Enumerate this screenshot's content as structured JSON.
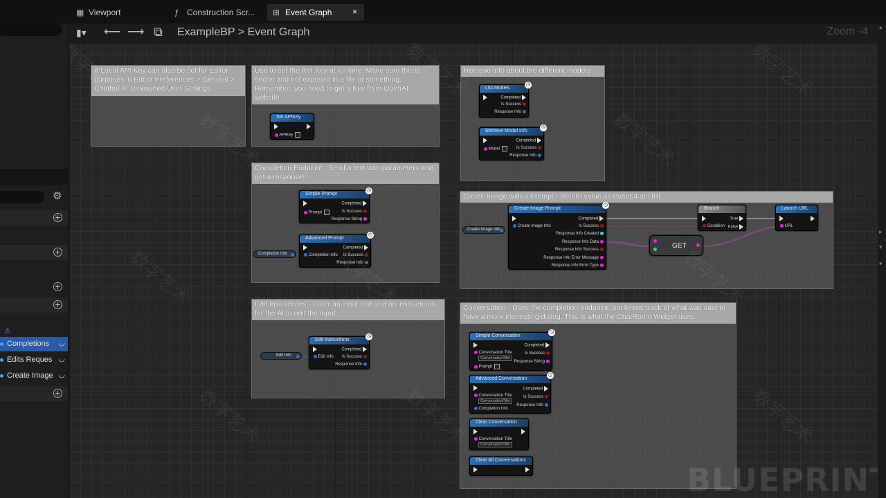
{
  "tabs": [
    {
      "label": "Viewport",
      "icon": "viewport-icon"
    },
    {
      "label": "Construction Scr...",
      "icon": "function-icon"
    },
    {
      "label": "Event Graph",
      "icon": "graph-icon",
      "close": "×"
    }
  ],
  "toolbar": {
    "breadcrumb_root": "ExampleBP",
    "separator": ">",
    "breadcrumb_leaf": "Event Graph",
    "zoom": "Zoom -4"
  },
  "left_panel": {
    "items": [
      {
        "label": "Completions"
      },
      {
        "label": "Edits Reques"
      },
      {
        "label": "Create Image"
      }
    ]
  },
  "comments": [
    {
      "text": "A Local API Key can also be set for Editor purposes in Editor Preferences > General > Chatbot AI Unleashed User Settings"
    },
    {
      "text": "Use to set the API Key at runtime. Make sure this is secret and not exposed in a file or something. Remember, you need to get a Key from OpenAI website."
    },
    {
      "text": "Retrieve info about the different models"
    },
    {
      "text": "Completion Endpoint : Send a text with parameters and get a response!"
    },
    {
      "text": "Create Image with a Prompt - Return value as Base64 or URL"
    },
    {
      "text": "Edit Instructions - Enter an input text and an instructions for the AI to edit the input."
    },
    {
      "text": "Conversation - Uses the completion endpoint, but keeps track of what was said to have a more interesting dialog. This is what the ChatRoom Widget uses."
    }
  ],
  "nodes": {
    "set_apikey": {
      "title": "Set APIKey",
      "pin": "APIKey"
    },
    "list_models": {
      "title": "List Models",
      "p1": "Completed",
      "p2": "Is Success",
      "p3": "Response Info"
    },
    "retrieve_model": {
      "title": "Retrieve Model Info",
      "in": "Model",
      "p1": "Completed",
      "p2": "Is Success",
      "p3": "Response Info"
    },
    "simple_prompt": {
      "title": "Simple Prompt",
      "in": "Prompt",
      "p1": "Completed",
      "p2": "Is Success",
      "p3": "Response String"
    },
    "advanced_prompt": {
      "title": "Advanced Prompt",
      "in": "Completion Info",
      "p1": "Completed",
      "p2": "Is Success",
      "p3": "Response Info"
    },
    "completion_var": {
      "title": "Completion Info"
    },
    "create_image": {
      "title": "Create Image Prompt",
      "in": "Create Image Info",
      "p1": "Completed",
      "p2": "Is Success",
      "p3": "Response Info Created",
      "p4": "Response Info Data",
      "p5": "Response Info Success",
      "p6": "Response Info Error Message",
      "p7": "Response Info Error Type"
    },
    "create_image_var": {
      "title": "Create Image Info"
    },
    "branch": {
      "title": "Branch",
      "in": "Condition",
      "p1": "True",
      "p2": "False"
    },
    "get": {
      "title": "GET"
    },
    "launch_url": {
      "title": "Launch URL",
      "in": "URL"
    },
    "edit_instructions": {
      "title": "Edit Instructions",
      "in": "Edit Info",
      "p1": "Completed",
      "p2": "Is Success",
      "p3": "Response Info"
    },
    "edit_var": {
      "title": "Edit Info"
    },
    "simple_conv": {
      "title": "Simple Conversation",
      "in1": "Conversation Title",
      "val1": "ConversationTitle",
      "in2": "Prompt",
      "p1": "Completed",
      "p2": "Is Success",
      "p3": "Response String"
    },
    "adv_conv": {
      "title": "Advanced Conversation",
      "in1": "Conversation Title",
      "val1": "ConversationTitle",
      "in2": "Completion Info",
      "p1": "Completed",
      "p2": "Is Success",
      "p3": "Response Info"
    },
    "clear_conv": {
      "title": "Clear Conversation",
      "in1": "Conversation Title",
      "val1": "ConversationTitle"
    },
    "clear_all": {
      "title": "Clear All Conversations"
    }
  },
  "watermark": {
    "text": "数字艺术",
    "brand": "BLUEPRINT"
  }
}
